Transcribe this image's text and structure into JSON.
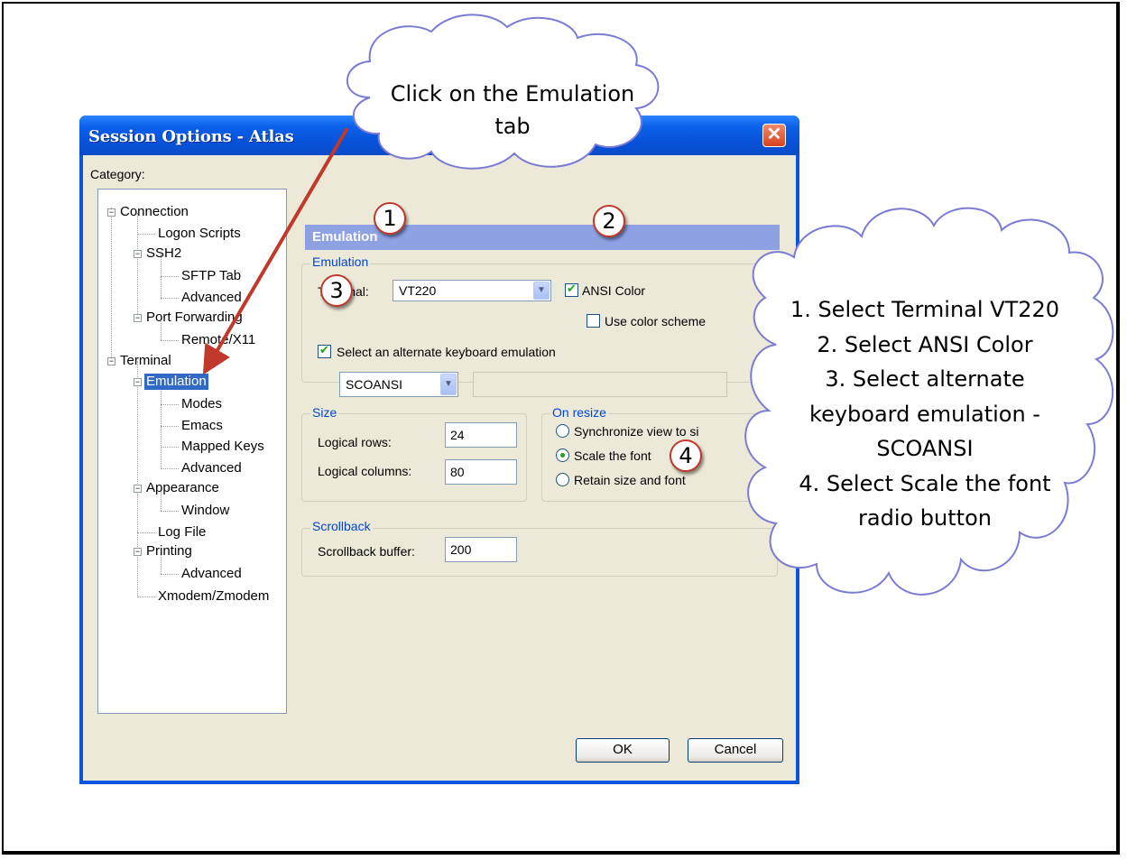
{
  "callout_top": {
    "line1": "Click on the Emulation",
    "line2": "tab"
  },
  "callout_right": {
    "lines": [
      "1. Select Terminal VT220",
      "2. Select ANSI Color",
      "3. Select alternate",
      "keyboard emulation -",
      "SCOANSI",
      "4. Select Scale the font",
      "radio button"
    ]
  },
  "dialog": {
    "title": "Session Options - Atlas",
    "close_symbol": "✕",
    "category_label": "Category:",
    "tree": [
      "Connection",
      "Logon Scripts",
      "SSH2",
      "SFTP Tab",
      "Advanced",
      "Port Forwarding",
      "Remote/X11",
      "Terminal",
      "Emulation",
      "Modes",
      "Emacs",
      "Mapped Keys",
      "Advanced",
      "Appearance",
      "Window",
      "Log File",
      "Printing",
      "Advanced",
      "Xmodem/Zmodem"
    ],
    "expander_symbol": "−",
    "panel_title": "Emulation",
    "emulation_group": {
      "label": "Emulation",
      "terminal_label": "Terminal:",
      "terminal_value": "VT220",
      "ansi_color": "ANSI Color",
      "use_color_scheme": "Use color scheme",
      "alternate_keyboard": "Select an alternate keyboard emulation",
      "keyboard_value": "SCOANSI"
    },
    "size_group": {
      "label": "Size",
      "rows_label": "Logical rows:",
      "rows_value": "24",
      "cols_label": "Logical columns:",
      "cols_value": "80"
    },
    "resize_group": {
      "label": "On resize",
      "opt1": "Synchronize view to si",
      "opt2": "Scale the font",
      "opt3": "Retain size and font"
    },
    "scrollback_group": {
      "label": "Scrollback",
      "buffer_label": "Scrollback buffer:",
      "buffer_value": "200"
    },
    "ok": "OK",
    "cancel": "Cancel"
  },
  "badges": [
    "1",
    "2",
    "3",
    "4"
  ],
  "dropdown_arrow": "▼",
  "colors": {
    "title_bar": "#0a5fe8",
    "selection": "#316ac5",
    "cloud_fill": "#ffffff",
    "cloud_stroke": "#7b7bd6",
    "arrow": "#c0392b",
    "group_label": "#0046d5"
  }
}
